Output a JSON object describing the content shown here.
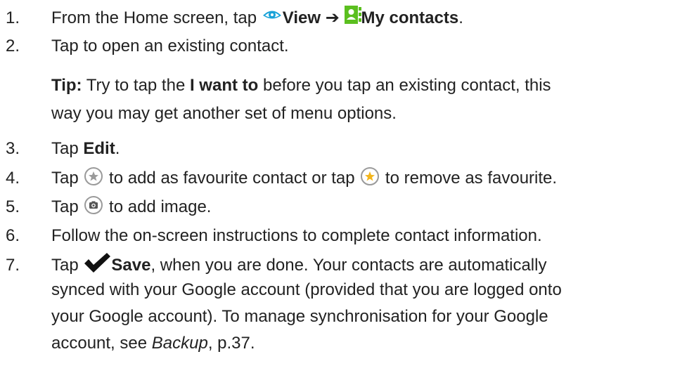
{
  "steps": [
    {
      "num": "1.",
      "prefix": "From the Home screen, tap ",
      "view": "View",
      "arrow": "➔",
      "contacts": "My contacts",
      "suffix": "."
    },
    {
      "num": "2.",
      "text": "Tap to open an existing contact."
    },
    {
      "num": "3.",
      "prefix": "Tap ",
      "bold": "Edit",
      "suffix": "."
    },
    {
      "num": "4.",
      "prefix": "Tap ",
      "middle": " to add as favourite contact or tap ",
      "suffix": " to remove as favourite."
    },
    {
      "num": "5.",
      "prefix": "Tap ",
      "suffix": " to add image."
    },
    {
      "num": "6.",
      "text": "Follow the on-screen instructions to complete contact information."
    },
    {
      "num": "7.",
      "prefix": "Tap ",
      "bold": "Save",
      "line1": ", when you are done. Your contacts are automatically",
      "line2": "synced with your Google account (provided that you are logged onto",
      "line3": "your Google account). To manage synchronisation for your Google",
      "line4_pre": "account, see ",
      "line4_ital": "Backup",
      "line4_post": ", p.37."
    }
  ],
  "tip": {
    "label": "Tip:",
    "pre": " Try to tap the ",
    "bold": "I want to",
    "post1": " before you tap an existing contact, this",
    "line2": "way you may get another set of menu options."
  },
  "icons": {
    "view": "eye-icon",
    "contacts": "contacts-book-icon",
    "fav_add": "star-outline-icon",
    "fav_remove": "star-gold-icon",
    "camera": "camera-icon",
    "save": "checkmark-icon"
  },
  "colors": {
    "text": "#222222",
    "view_icon": "#19a2d8",
    "contacts_icon": "#5bbf1f",
    "star_gold": "#f3b51b",
    "icon_gray": "#9a9a9a"
  }
}
